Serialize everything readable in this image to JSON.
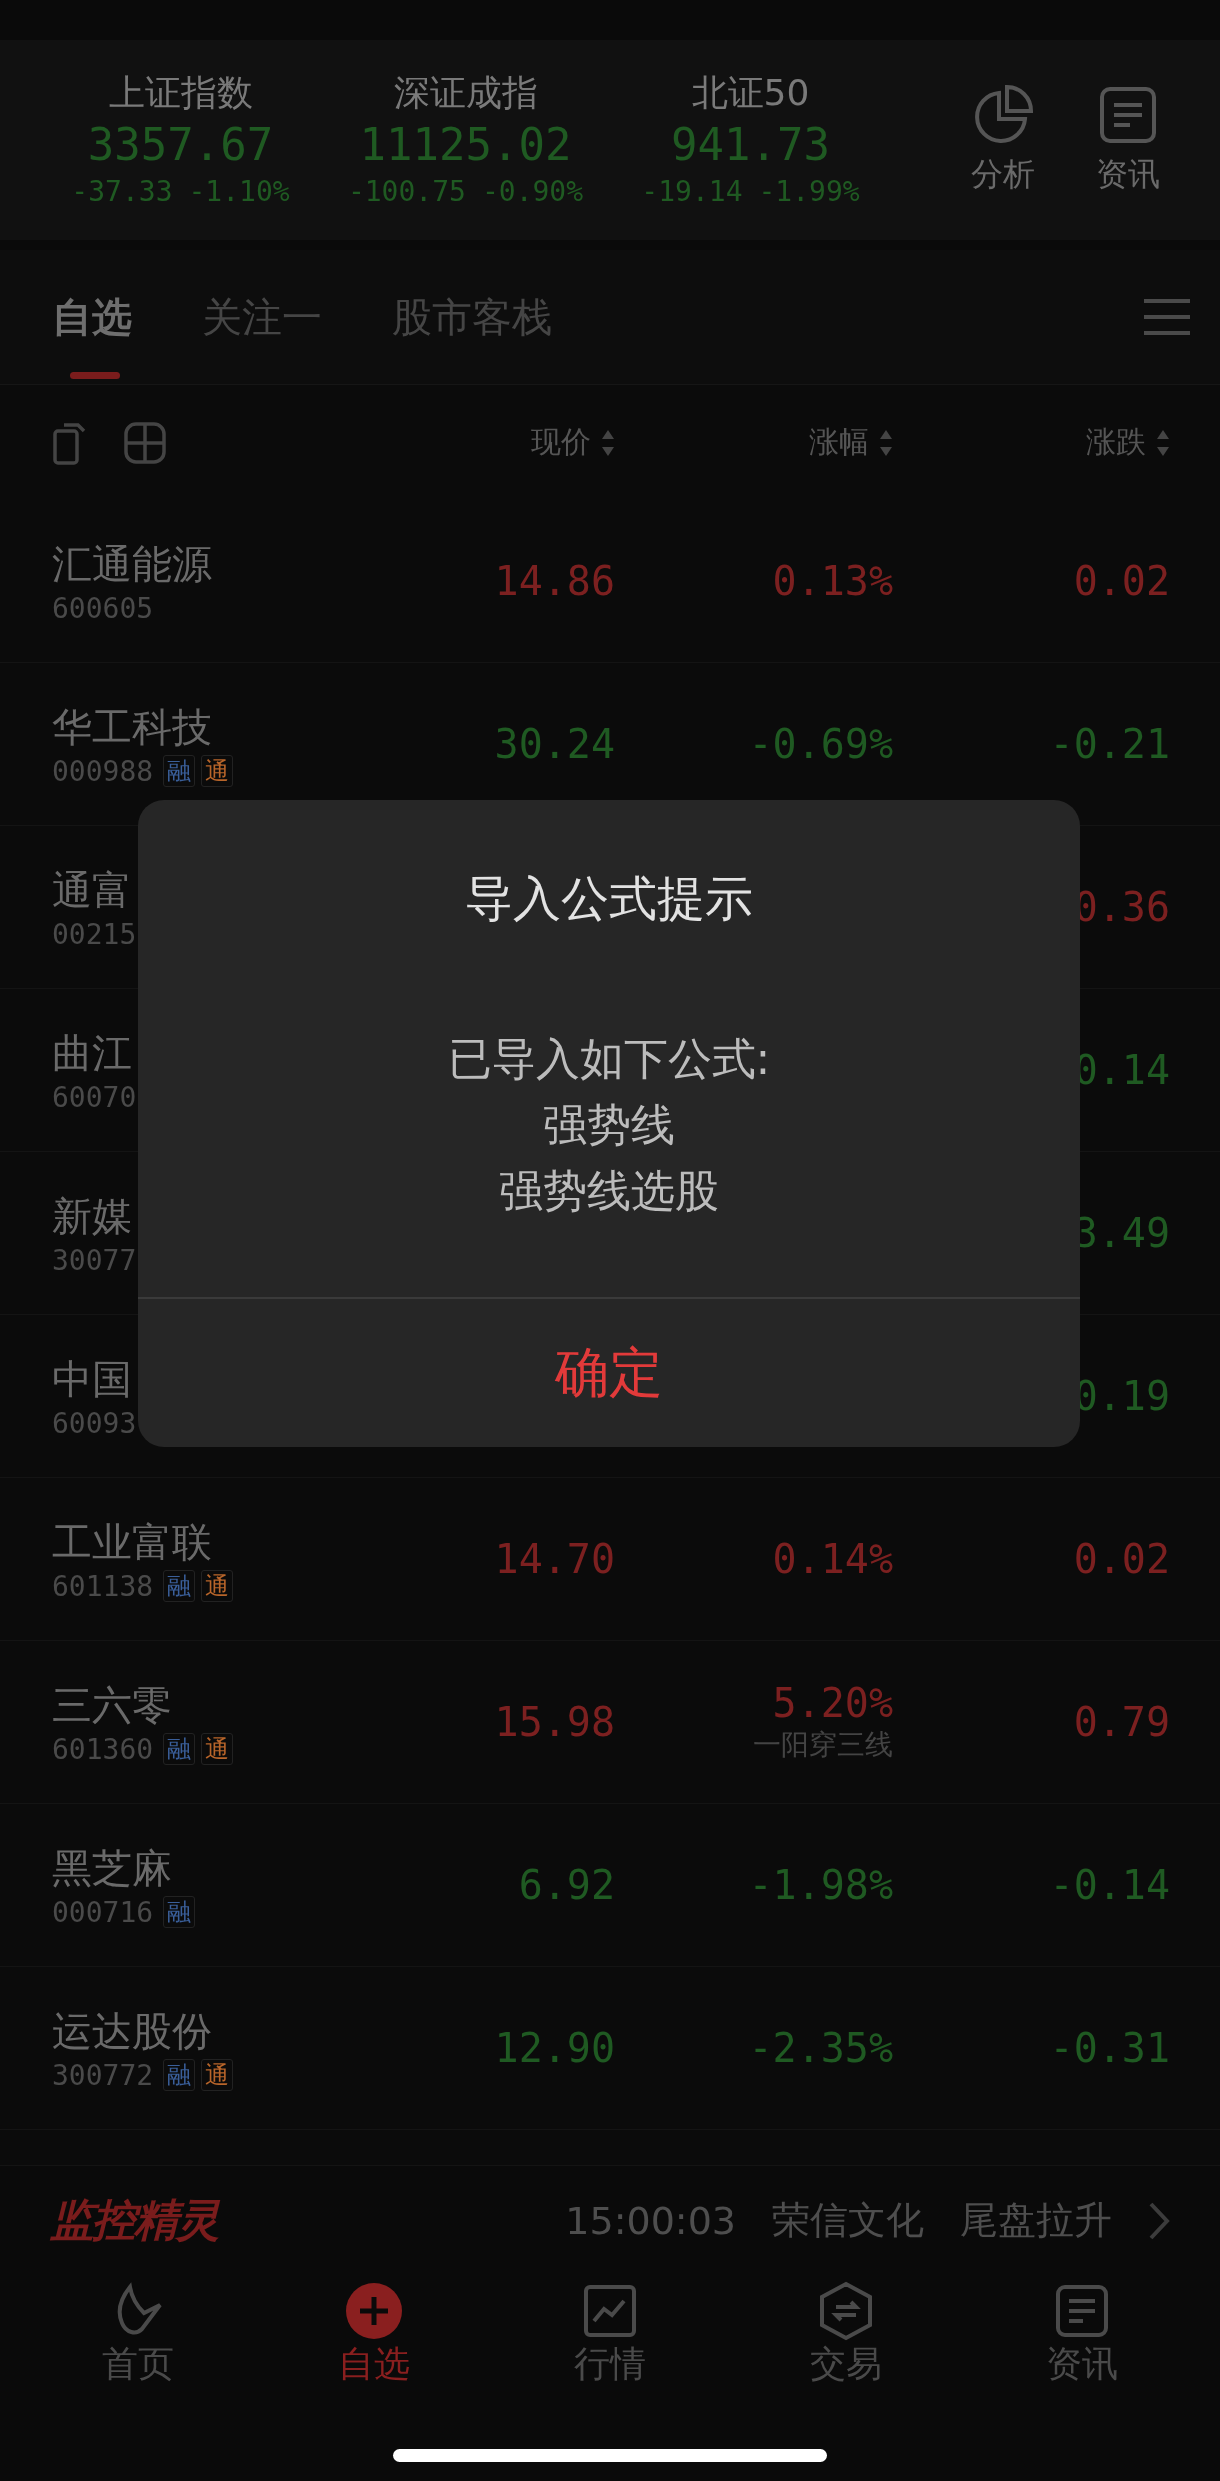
{
  "indices": [
    {
      "name": "上证指数",
      "value": "3357.67",
      "change": "-37.33",
      "percent": "-1.10%",
      "kind": "down"
    },
    {
      "name": "深证成指",
      "value": "11125.02",
      "change": "-100.75",
      "percent": "-0.90%",
      "kind": "down"
    },
    {
      "name": "北证50",
      "value": "941.73",
      "change": "-19.14",
      "percent": "-1.99%",
      "kind": "down"
    }
  ],
  "header_actions": [
    {
      "label": "分析",
      "kind": "chart"
    },
    {
      "label": "资讯",
      "kind": "news"
    }
  ],
  "tabs": [
    {
      "label": "自选",
      "selected": true
    },
    {
      "label": "关注一",
      "selected": false
    },
    {
      "label": "股市客栈",
      "selected": false
    }
  ],
  "columns": [
    "现价",
    "涨幅",
    "涨跌"
  ],
  "rows": [
    {
      "name": "汇通能源",
      "code": "600605",
      "tags": [],
      "price": "14.86",
      "percent": "0.13%",
      "change": "0.02",
      "kind": "up"
    },
    {
      "name": "华工科技",
      "code": "000988",
      "tags": [
        {
          "text": "融",
          "color": "#3a5f9a"
        },
        {
          "text": "通",
          "color": "#b8652a"
        }
      ],
      "price": "30.24",
      "percent": "-0.69%",
      "change": "-0.21",
      "kind": "down"
    },
    {
      "name": "通富",
      "code": "00215",
      "tags": [],
      "change": "0.36",
      "kind": "up"
    },
    {
      "name": "曲江",
      "code": "60070",
      "tags": [],
      "change": "0.14",
      "kind": "down"
    },
    {
      "name": "新媒",
      "code": "30077",
      "tags": [],
      "change": "3.49",
      "kind": "down"
    },
    {
      "name": "中国",
      "code": "60093",
      "tags": [],
      "change": "0.19",
      "kind": "down"
    },
    {
      "name": "工业富联",
      "code": "601138",
      "tags": [
        {
          "text": "融",
          "color": "#3a5f9a"
        },
        {
          "text": "通",
          "color": "#b8652a"
        }
      ],
      "price": "14.70",
      "percent": "0.14%",
      "change": "0.02",
      "kind": "up"
    },
    {
      "name": "三六零",
      "code": "601360",
      "tags": [
        {
          "text": "融",
          "color": "#3a5f9a"
        },
        {
          "text": "通",
          "color": "#b8652a"
        }
      ],
      "price": "15.98",
      "percent": "5.20%",
      "note": "一阳穿三线",
      "change": "0.79",
      "kind": "up"
    },
    {
      "name": "黑芝麻",
      "code": "000716",
      "tags": [
        {
          "text": "融",
          "color": "#3a5f9a"
        }
      ],
      "price": "6.92",
      "percent": "-1.98%",
      "change": "-0.14",
      "kind": "down"
    },
    {
      "name": "运达股份",
      "code": "300772",
      "tags": [
        {
          "text": "融",
          "color": "#3a5f9a"
        },
        {
          "text": "通",
          "color": "#b8652a"
        }
      ],
      "price": "12.90",
      "percent": "-2.35%",
      "change": "-0.31",
      "kind": "down"
    }
  ],
  "ticker": {
    "logo": "监控精灵",
    "time": "15:00:03",
    "stock": "荣信文化",
    "signal": "尾盘拉升"
  },
  "dialog": {
    "title": "导入公式提示",
    "message": [
      "已导入如下公式:",
      "强势线",
      "强势线选股"
    ],
    "button": "确定"
  },
  "nav": [
    {
      "label": "首页",
      "kind": "home",
      "selected": false
    },
    {
      "label": "自选",
      "kind": "add",
      "selected": true
    },
    {
      "label": "行情",
      "kind": "chart",
      "selected": false
    },
    {
      "label": "交易",
      "kind": "trade",
      "selected": false
    },
    {
      "label": "资讯",
      "kind": "news",
      "selected": false
    }
  ]
}
